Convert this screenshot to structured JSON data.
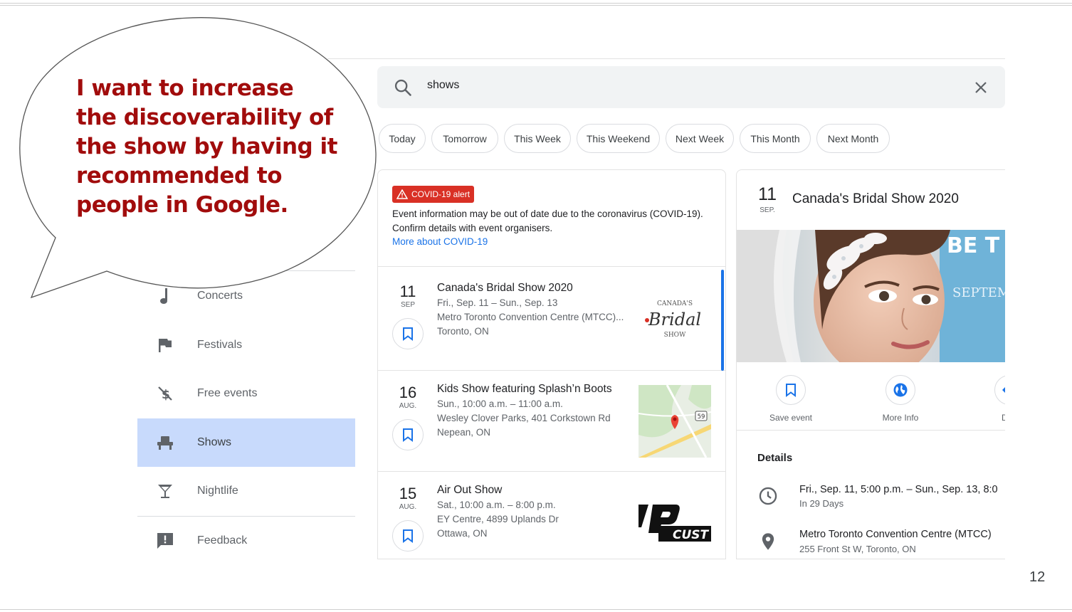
{
  "callout": {
    "text": "I want to increase the discoverability of the show by having it recommended to people in Google."
  },
  "search": {
    "query": "shows",
    "icon": "search-icon",
    "clear_icon": "close-icon"
  },
  "chips": [
    "Today",
    "Tomorrow",
    "This Week",
    "This Weekend",
    "Next Week",
    "This Month",
    "Next Month"
  ],
  "sidebar": {
    "items": [
      {
        "label": "Concerts",
        "icon": "music-note-icon",
        "active": false
      },
      {
        "label": "Festivals",
        "icon": "flag-icon",
        "active": false
      },
      {
        "label": "Free events",
        "icon": "no-money-icon",
        "active": false
      },
      {
        "label": "Shows",
        "icon": "theater-seat-icon",
        "active": true
      },
      {
        "label": "Nightlife",
        "icon": "cocktail-icon",
        "active": false
      },
      {
        "label": "Feedback",
        "icon": "feedback-icon",
        "active": false
      }
    ]
  },
  "covid": {
    "badge": "COVID-19 alert",
    "line1": "Event information may be out of date due to the coronavirus (COVID-19).",
    "line2": "Confirm details with event organisers.",
    "link": "More about COVID-19"
  },
  "events": [
    {
      "day": "11",
      "month": "SEP",
      "title": "Canada's Bridal Show 2020",
      "dates": "Fri., Sep. 11 – Sun., Sep. 13",
      "venue": "Metro Toronto Convention Centre (MTCC)...",
      "city": "Toronto, ON",
      "thumb_line1": "CANADA'S",
      "thumb_line2": "Bridal",
      "thumb_line3": "SHOW"
    },
    {
      "day": "16",
      "month": "AUG.",
      "title": "Kids Show featuring Splash’n Boots",
      "dates": "Sun., 10:00 a.m. – 11:00 a.m.",
      "venue": "Wesley Clover Parks, 401 Corkstown Rd",
      "city": "Nepean, ON",
      "thumb_badge": "59"
    },
    {
      "day": "15",
      "month": "AUG.",
      "title": "Air Out Show",
      "dates": "Sat., 10:00 a.m. – 8:00 p.m.",
      "venue": "EY Centre, 4899 Uplands Dr",
      "city": "Ottawa, ON",
      "thumb_text": "CUST"
    }
  ],
  "detail": {
    "day": "11",
    "month": "SEP.",
    "title": "Canada's Bridal Show 2020",
    "hero_text1": "BE T",
    "hero_text2": "SEPTEM",
    "actions": [
      {
        "label": "Save event",
        "icon": "bookmark-icon"
      },
      {
        "label": "More Info",
        "icon": "globe-icon"
      },
      {
        "label": "Dire",
        "icon": "directions-icon"
      }
    ],
    "details_heading": "Details",
    "when": "Fri., Sep. 11, 5:00 p.m. – Sun., Sep. 13, 8:0",
    "when_sub": "In 29 Days",
    "where": "Metro Toronto Convention Centre (MTCC)",
    "where_sub": "255 Front St W, Toronto, ON"
  },
  "page_number": "12",
  "colors": {
    "accent": "#1a73e8",
    "callout_text": "#a10c0c",
    "active_nav": "#c8dafc",
    "alert": "#d93025"
  }
}
